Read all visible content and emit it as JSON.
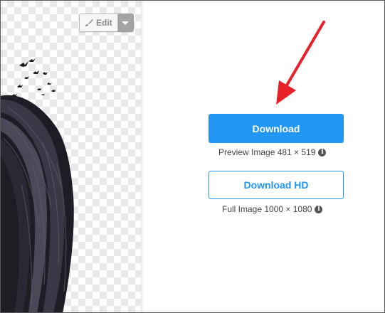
{
  "edit_control": {
    "label": "Edit",
    "icon": "brush-icon",
    "toggle_icon": "caret-down-icon"
  },
  "downloads": {
    "primary_label": "Download",
    "preview_caption": "Preview Image 481 × 519",
    "hd_label": "Download HD",
    "full_caption": "Full Image 1000 × 1080",
    "info_icon_glyph": "i"
  },
  "colors": {
    "accent": "#2196f3",
    "annotation_arrow": "#e8202a",
    "checker": "#e9e9e9"
  }
}
